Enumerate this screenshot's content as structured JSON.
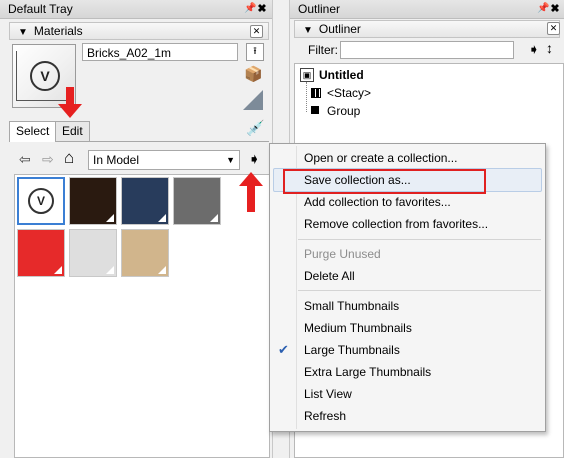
{
  "left_tray": {
    "title": "Default Tray",
    "pin_icon": "pin-icon",
    "close_icon": "close-icon"
  },
  "materials": {
    "section_title": "Materials",
    "material_name": "Bricks_A02_1m",
    "tabs": [
      "Select",
      "Edit"
    ],
    "collection": "In Model",
    "swatches": [
      {
        "color": "#ffffff",
        "selected": true,
        "icon": "vray-material-icon"
      },
      {
        "color": "#2a1a10"
      },
      {
        "color": "#283c5c"
      },
      {
        "color": "#6c6c6c"
      },
      {
        "color": "#e62a2a"
      },
      {
        "color": "#dedede"
      },
      {
        "color": "#d1b58c"
      }
    ]
  },
  "outliner_tray": {
    "title": "Outliner",
    "section_title": "Outliner",
    "filter_label": "Filter:",
    "filter_value": "",
    "tree": {
      "root": "Untitled",
      "children": [
        "<Stacy>",
        "Group"
      ]
    }
  },
  "context_menu": {
    "items": [
      {
        "label": "Open or create a collection...",
        "enabled": true
      },
      {
        "label": "Save collection as...",
        "enabled": true,
        "highlighted": true
      },
      {
        "label": "Add collection to favorites...",
        "enabled": true
      },
      {
        "label": "Remove collection from favorites...",
        "enabled": true
      },
      {
        "label": "Purge Unused",
        "enabled": false
      },
      {
        "label": "Delete All",
        "enabled": true
      },
      {
        "label": "Small Thumbnails",
        "enabled": true
      },
      {
        "label": "Medium Thumbnails",
        "enabled": true
      },
      {
        "label": "Large Thumbnails",
        "enabled": true,
        "checked": true
      },
      {
        "label": "Extra Large Thumbnails",
        "enabled": true
      },
      {
        "label": "List View",
        "enabled": true
      },
      {
        "label": "Refresh",
        "enabled": true
      }
    ]
  },
  "colors": {
    "annotation_red": "#e62020",
    "selection_blue": "#3b7fd4"
  }
}
